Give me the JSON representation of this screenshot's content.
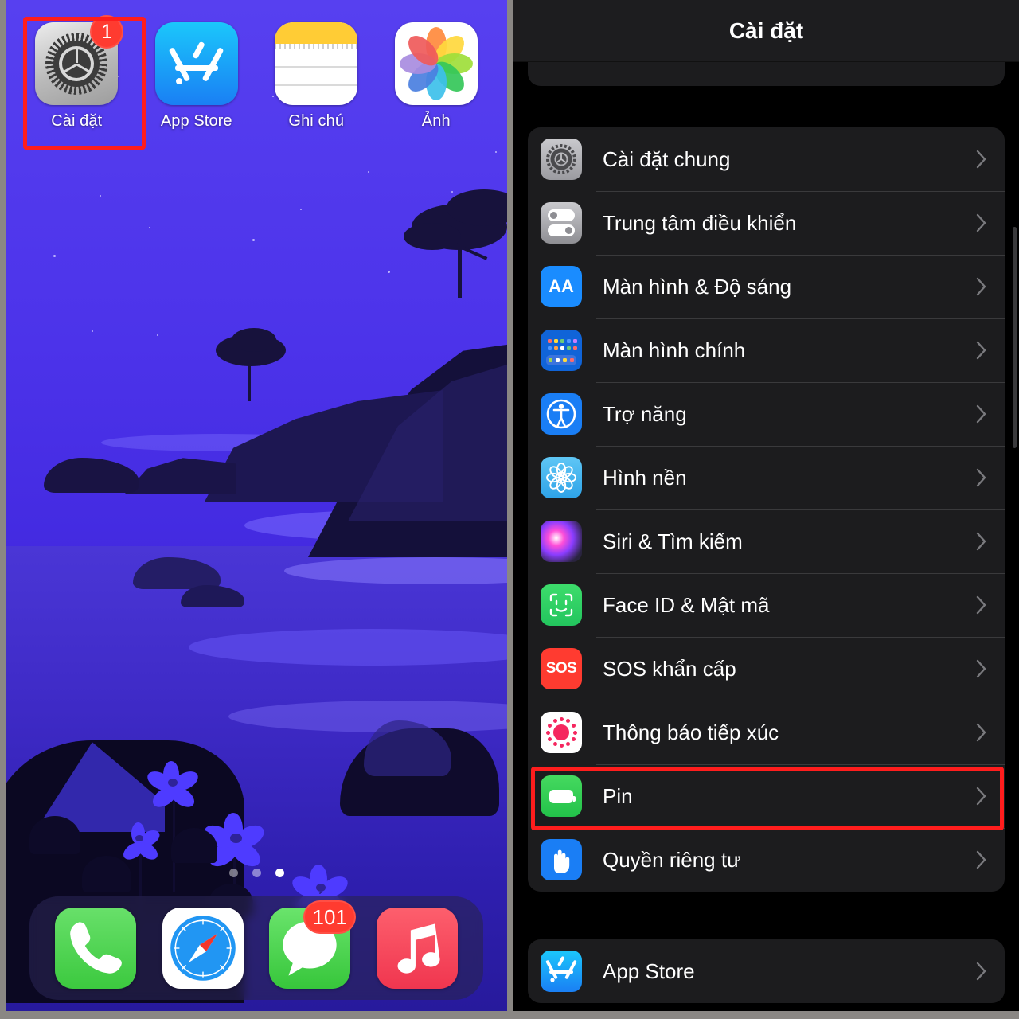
{
  "home_screen": {
    "apps": [
      {
        "label": "Cài đặt",
        "icon": "settings-gear-icon",
        "badge": "1",
        "highlighted": true
      },
      {
        "label": "App Store",
        "icon": "app-store-icon",
        "badge": null,
        "highlighted": false
      },
      {
        "label": "Ghi chú",
        "icon": "notes-icon",
        "badge": null,
        "highlighted": false
      },
      {
        "label": "Ảnh",
        "icon": "photos-icon",
        "badge": null,
        "highlighted": false
      }
    ],
    "page_dots": {
      "count": 3,
      "active_index": 2
    },
    "dock": [
      {
        "name": "Phone",
        "icon": "phone-icon",
        "badge": null
      },
      {
        "name": "Safari",
        "icon": "safari-icon",
        "badge": null
      },
      {
        "name": "Messages",
        "icon": "messages-icon",
        "badge": "101"
      },
      {
        "name": "Music",
        "icon": "music-icon",
        "badge": null
      }
    ]
  },
  "settings": {
    "nav_title": "Cài đặt",
    "groups": [
      {
        "partial_top": true,
        "rows": [
          {
            "label": "",
            "icon": "generic-purple-icon",
            "chevron": true
          }
        ]
      },
      {
        "partial_top": false,
        "rows": [
          {
            "label": "Cài đặt chung",
            "icon": "general-gear-icon",
            "chevron": true,
            "highlighted": false
          },
          {
            "label": "Trung tâm điều khiển",
            "icon": "control-center-icon",
            "chevron": true,
            "highlighted": false
          },
          {
            "label": "Màn hình & Độ sáng",
            "icon": "display-brightness-icon",
            "chevron": true,
            "highlighted": false
          },
          {
            "label": "Màn hình chính",
            "icon": "home-screen-icon",
            "chevron": true,
            "highlighted": false
          },
          {
            "label": "Trợ năng",
            "icon": "accessibility-icon",
            "chevron": true,
            "highlighted": false
          },
          {
            "label": "Hình nền",
            "icon": "wallpaper-icon",
            "chevron": true,
            "highlighted": false
          },
          {
            "label": "Siri & Tìm kiếm",
            "icon": "siri-icon",
            "chevron": true,
            "highlighted": false
          },
          {
            "label": "Face ID & Mật mã",
            "icon": "face-id-icon",
            "chevron": true,
            "highlighted": false
          },
          {
            "label": "SOS khẩn cấp",
            "icon": "sos-icon",
            "chevron": true,
            "highlighted": false
          },
          {
            "label": "Thông báo tiếp xúc",
            "icon": "exposure-notification-icon",
            "chevron": true,
            "highlighted": false
          },
          {
            "label": "Pin",
            "icon": "battery-icon",
            "chevron": true,
            "highlighted": true
          },
          {
            "label": "Quyền riêng tư",
            "icon": "privacy-hand-icon",
            "chevron": true,
            "highlighted": false
          }
        ]
      },
      {
        "partial_top": false,
        "rows": [
          {
            "label": "App Store",
            "icon": "app-store-icon",
            "chevron": true,
            "highlighted": false
          }
        ]
      }
    ],
    "sos_icon_text": "SOS",
    "display_icon_text": "AA"
  },
  "annotations": {
    "highlight_color": "#ff1d1d",
    "boxes": [
      {
        "target": "settings-app-icon",
        "panel": "home-screen"
      },
      {
        "target": "pin-settings-row",
        "panel": "settings"
      }
    ]
  },
  "colors": {
    "page_border": "#8a8784",
    "settings_bg": "#000000",
    "settings_group_bg": "#1c1c1e",
    "settings_nav_bg": "#1d1d1f",
    "wallpaper_sky": "#4c33ea",
    "badge_red": "#ff3b30"
  }
}
